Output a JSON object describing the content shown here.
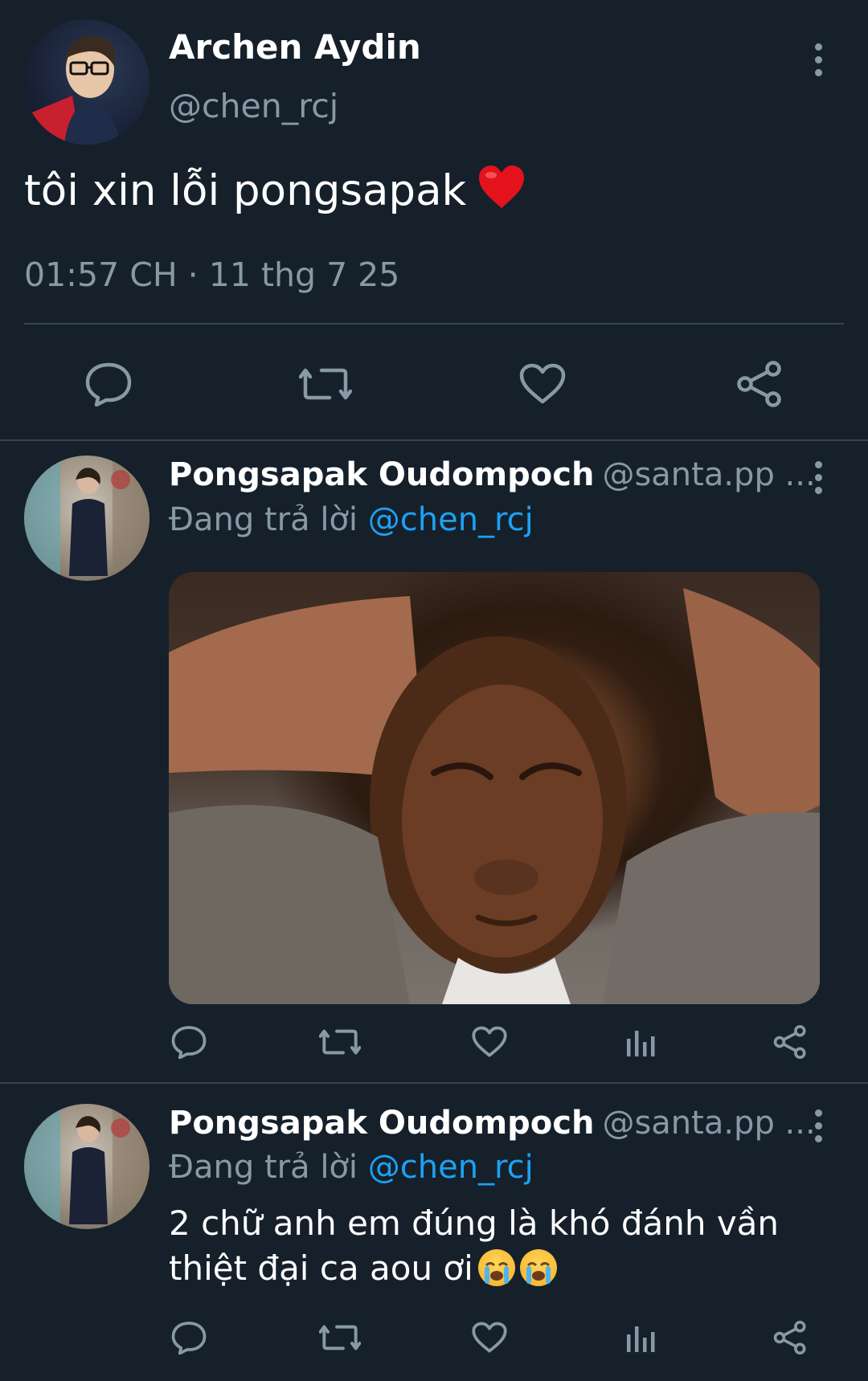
{
  "main_tweet": {
    "author_name": "Archen Aydin",
    "author_handle": "@chen_rcj",
    "text": "tôi xin lỗi pongsapak",
    "emoji": "red-heart",
    "timestamp": "01:57 CH · 11 thg 7 25",
    "actions": [
      "reply-icon",
      "retweet-icon",
      "like-icon",
      "share-icon"
    ]
  },
  "replies": [
    {
      "author_name": "Pongsapak Oudompoch",
      "author_handle": "@santa.pp ...",
      "replying_prefix": "Đang trả lời",
      "replying_to": "@chen_rcj",
      "has_media": true,
      "text": "",
      "actions": [
        "reply-icon",
        "retweet-icon",
        "like-icon",
        "analytics-icon",
        "share-icon"
      ]
    },
    {
      "author_name": "Pongsapak Oudompoch",
      "author_handle": "@santa.pp ...",
      "replying_prefix": "Đang trả lời",
      "replying_to": "@chen_rcj",
      "has_media": false,
      "text_line1": "2 chữ anh em đúng là khó đánh vần",
      "text_line2": "thiệt đại ca aou ơi",
      "emoji": "loudly-crying-face x2",
      "actions": [
        "reply-icon",
        "retweet-icon",
        "like-icon",
        "analytics-icon",
        "share-icon"
      ]
    }
  ],
  "colors": {
    "background": "#15202b",
    "text": "#ffffff",
    "secondary": "#8899a6",
    "link": "#1da1f2",
    "divider": "#38444d"
  }
}
